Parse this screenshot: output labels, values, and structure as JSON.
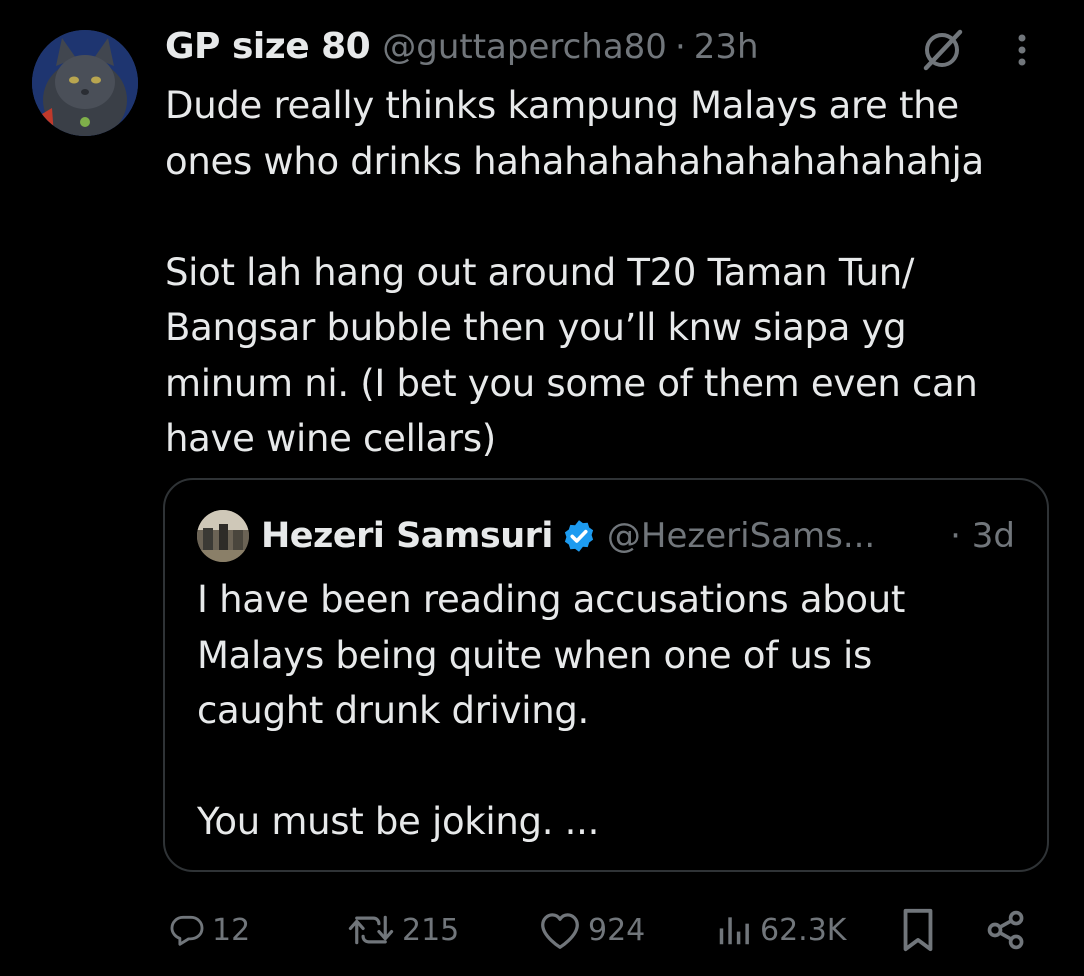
{
  "post": {
    "author": {
      "display_name": "GP size 80",
      "handle": "@guttapercha80",
      "avatar_icon": "cat-avatar"
    },
    "separator": "·",
    "time": "23h",
    "header_icons": [
      "grok-icon",
      "more-icon"
    ],
    "text": "Dude really thinks kampung Malays are the\nones who drinks hahahahahahahahahahahja\n\nSiot lah hang out around T20 Taman Tun/\nBangsar bubble then you’ll knw siapa yg\nminum ni. (I bet you some of them even can\nhave wine cellars)"
  },
  "quoted_post": {
    "author": {
      "display_name": "Hezeri Samsuri",
      "handle": "@HezeriSams...",
      "verified": true,
      "avatar_icon": "photo-avatar"
    },
    "time": "· 3d",
    "text": "I have been reading accusations about\nMalays being quite when one of us is\ncaught drunk driving.\n\nYou must be joking. ..."
  },
  "actions": {
    "replies": "12",
    "reposts": "215",
    "likes": "924",
    "views": "62.3K"
  },
  "colors": {
    "background": "#000000",
    "primary_text": "#e7e9ea",
    "secondary_text": "#71767b",
    "border": "#2f3336",
    "verified_badge": "#1d9bf0"
  }
}
